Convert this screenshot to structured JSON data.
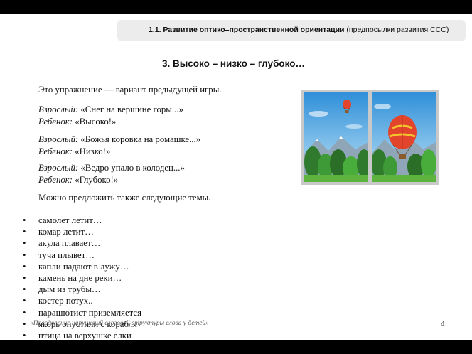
{
  "header": {
    "section_bold": "1.1. Развитие оптико–пространственной ориентации",
    "section_note": "(предпосылки развития ССС)"
  },
  "title": "3. Высоко – низко – глубоко…",
  "intro": "Это упражнение — вариант предыдущей игры.",
  "dialogues": [
    {
      "adult_label": "Взрослый:",
      "adult_text": "«Снег на вершине горы...»",
      "child_label": "Ребенок:",
      "child_text": "«Высоко!»"
    },
    {
      "adult_label": "Взрослый:",
      "adult_text": "«Божья коровка на ромашке...»",
      "child_label": "Ребенок:",
      "child_text": "«Низко!»"
    },
    {
      "adult_label": "Взрослый:",
      "adult_text": "«Ведро упало в колодец...»",
      "child_label": "Ребенок:",
      "child_text": "«Глубоко!»"
    }
  ],
  "suggestion": "Можно предложить также следующие темы.",
  "topics": [
    "самолет летит…",
    "комар летит…",
    "акула плавает…",
    "туча плывет…",
    "капли падают в лужу…",
    "камень на дне реки…",
    "дым из трубы…",
    "костер потух..",
    "парашютист приземляется",
    "якорь опустили с корабля",
    "птица на верхушке елки"
  ],
  "footer": "«Преодоление нарушений слоговой структуры слова у детей»",
  "page_number": "4",
  "images": [
    {
      "name": "balloon-high-photo",
      "balloon": "small, high in the sky"
    },
    {
      "name": "balloon-low-photo",
      "balloon": "large, low over the trees"
    }
  ]
}
